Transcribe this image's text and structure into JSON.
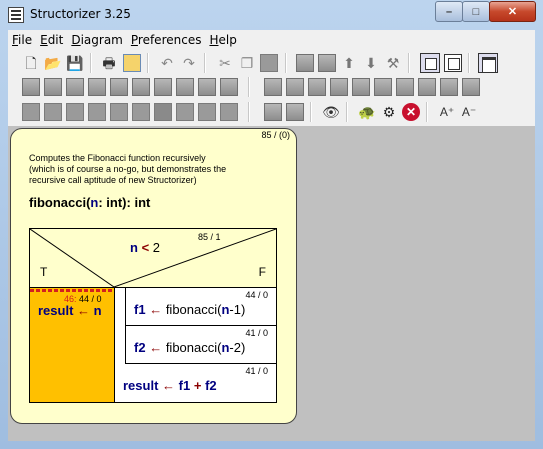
{
  "window": {
    "title": "Structorizer 3.25"
  },
  "menu": [
    {
      "label": "File",
      "accel": "F",
      "rest": "ile"
    },
    {
      "label": "Edit",
      "accel": "E",
      "rest": "dit"
    },
    {
      "label": "Diagram",
      "accel": "D",
      "rest": "iagram"
    },
    {
      "label": "Preferences",
      "accel": "P",
      "rest": "references"
    },
    {
      "label": "Help",
      "accel": "H",
      "rest": "elp"
    }
  ],
  "toolbar_icons": {
    "row1": [
      "new-file-icon",
      "open-folder-icon",
      "save-icon",
      "print-icon",
      "export-picture-icon",
      "undo-icon",
      "redo-icon",
      "cut-icon",
      "copy-icon",
      "paste-icon",
      "edit-icon",
      "delete-icon",
      "move-up-icon",
      "move-down-icon",
      "transmute-icon",
      "view-mode-icon",
      "view-mode-alt-icon",
      "arrangement-icon"
    ],
    "row2": [
      "add-instruction-icon",
      "add-alternative-icon",
      "add-case-icon",
      "add-for-icon",
      "add-while-icon",
      "add-repeat-icon",
      "add-forever-icon",
      "add-call-icon",
      "add-jump-icon",
      "add-parallel-icon",
      "add-instruction-after-icon",
      "add-alternative-after-icon",
      "add-case-after-icon",
      "add-for-after-icon",
      "add-while-after-icon",
      "add-repeat-after-icon",
      "add-forever-after-icon",
      "add-call-after-icon",
      "add-jump-after-icon",
      "add-parallel-after-icon"
    ],
    "row3": [
      "color-white-icon",
      "color-gray1-icon",
      "color-gray2-icon",
      "color-gray3-icon",
      "color-gray4-icon",
      "color-gray5-icon",
      "color-gray6-icon",
      "color-gray7-icon",
      "color-gray8-icon",
      "color-gray9-icon",
      "collapse-icon",
      "expand-icon",
      "analyser-icon",
      "visibility-eye-icon",
      "turtle-icon",
      "executor-gear-icon",
      "breakpoint-off-icon",
      "font-up-icon",
      "font-down-icon"
    ]
  },
  "diagram": {
    "counter": "85 / (0)",
    "comment": "Computes the Fibonacci function recursively\n(which is of course a no-go, but demonstrates the\nrecursive call aptitude of new Structorizer)",
    "signature": {
      "name": "fibonacci(",
      "param": "n",
      "rest": ": int): int"
    },
    "alternative": {
      "counter": "85 / 1",
      "cond_var": "n",
      "cond_op": "<",
      "cond_val": "2",
      "true_label": "T",
      "false_label": "F"
    },
    "true_branch": {
      "counter_red": "46:",
      "counter": "44 / 0",
      "target": "result",
      "arrow": "←",
      "value": "n"
    },
    "false_branch": [
      {
        "counter": "44 / 0",
        "target": "f1",
        "arrow": "←",
        "call": "fibonacci(",
        "arg_var": "n",
        "arg_rest": "-1)"
      },
      {
        "counter": "41 / 0",
        "target": "f2",
        "arrow": "←",
        "call": "fibonacci(",
        "arg_var": "n",
        "arg_rest": "-2)"
      },
      {
        "counter": "41 / 0",
        "target": "result",
        "arrow": "←",
        "a": "f1",
        "op": "+",
        "b": "f2"
      }
    ]
  },
  "colors": {
    "diagram_bg": "#ffffcc",
    "true_branch_bg": "#ffc000",
    "canvas_bg": "#c0c0c0",
    "variable": "#000080",
    "operator": "#8b0000"
  }
}
